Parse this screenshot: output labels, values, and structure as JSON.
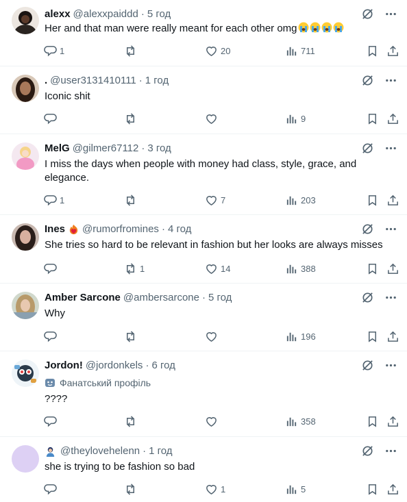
{
  "replies": [
    {
      "display_name": "alexx",
      "handle": "@alexxpaiddd",
      "time": "5 год",
      "text": "Her and that man were really meant for each other omg",
      "emojis": [
        "loudly-crying-face",
        "loudly-crying-face",
        "loudly-crying-face",
        "loudly-crying-face"
      ],
      "reply_count": "1",
      "repost_count": "",
      "like_count": "20",
      "view_count": "711",
      "avatar_colors": [
        "#3a2b22",
        "#1a1412"
      ]
    },
    {
      "display_name": ".",
      "handle": "@user3131410111",
      "time": "1 год",
      "text": "Iconic shit",
      "reply_count": "",
      "repost_count": "",
      "like_count": "",
      "view_count": "9",
      "avatar_colors": [
        "#5a3a2a",
        "#2a1a12"
      ]
    },
    {
      "display_name": "MelG",
      "handle": "@gilmer67112",
      "time": "3 год",
      "text": "I miss the days when people with money had class, style, grace, and elegance.",
      "reply_count": "1",
      "repost_count": "",
      "like_count": "7",
      "view_count": "203",
      "avatar_colors": [
        "#f4d9e8",
        "#e8a8c8"
      ]
    },
    {
      "display_name": "Ines",
      "handle": "@rumorfromines",
      "time": "4 год",
      "text": "She tries so hard to be relevant in fashion but her looks are always misses",
      "reply_count": "",
      "repost_count": "1",
      "like_count": "14",
      "view_count": "388",
      "avatar_colors": [
        "#8a6a5a",
        "#2a1e1a"
      ]
    },
    {
      "display_name": "Amber Sarcone",
      "handle": "@ambersarcone",
      "time": "5 год",
      "text": "Why",
      "reply_count": "",
      "repost_count": "",
      "like_count": "",
      "view_count": "196",
      "avatar_colors": [
        "#c8d0c4",
        "#8a9a8a"
      ]
    },
    {
      "display_name": "Jordon!",
      "handle": "@jordonkels",
      "time": "6 год",
      "fan_label": "Фанатський профіль",
      "text": "????",
      "reply_count": "",
      "repost_count": "",
      "like_count": "",
      "view_count": "358",
      "avatar_colors": [
        "#6aa8d8",
        "#2a4a6a"
      ]
    },
    {
      "display_name": "",
      "handle": "@theylovehelenn",
      "time": "1 год",
      "text": "she is trying to be fashion so bad",
      "reply_count": "",
      "repost_count": "",
      "like_count": "1",
      "view_count": "5",
      "avatar_colors": [
        "#ddd0f4",
        "#ddd0f4"
      ]
    }
  ],
  "icons": {
    "grok": "grok-slash-icon",
    "more": "more-dots-icon",
    "reply": "reply-bubble-icon",
    "repost": "repost-arrows-icon",
    "like": "heart-icon",
    "views": "views-bars-icon",
    "bookmark": "bookmark-icon",
    "share": "share-upload-icon"
  },
  "colors": {
    "text": "#0f1419",
    "secondary": "#536471",
    "divider": "#eff3f4"
  }
}
